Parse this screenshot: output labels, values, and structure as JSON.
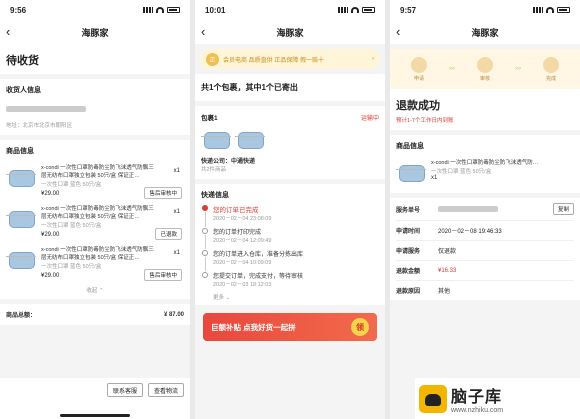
{
  "app_title": "海豚家",
  "screen1": {
    "time": "9:56",
    "page_title": "待收货",
    "recipient_label": "收货人信息",
    "address": "地址：北京市北京市朝阳区",
    "products_label": "商品信息",
    "products": [
      {
        "name": "x-condi 一次性口罩防毒防尘防飞沫透气防飘三层无纺布口罩独立包装 50只/盒 保证正…",
        "spec": "一次性口罩 蓝色 50只/盒",
        "price": "¥29.00",
        "qty": "x1",
        "action": "售后审核中"
      },
      {
        "name": "x-condi 一次性口罩防毒防尘防飞沫透气防飘三层无纺布口罩独立包装 50只/盒 保证正…",
        "spec": "一次性口罩 蓝色 50只/盒",
        "price": "¥29.00",
        "qty": "x1",
        "action": "已退款"
      },
      {
        "name": "x-condi 一次性口罩防毒防尘防飞沫透气防飘三层无纺布口罩独立包装 50只/盒 保证正…",
        "spec": "一次性口罩 蓝色 50只/盒",
        "price": "¥29.00",
        "qty": "x1",
        "action": "售后审核中"
      }
    ],
    "collapse": "收起 ⌃",
    "total_label": "商品总额：",
    "total_value": "¥ 87.00",
    "contact_btn": "联系客服",
    "logistics_btn": "查看物流"
  },
  "screen2": {
    "time": "10:01",
    "banner_text": "会员电商 品质直供   正品保障 假一赔十",
    "banner_icon": "正",
    "summary": "共1个包裹，其中1个已寄出",
    "package_label": "包裹1",
    "package_status": "运输中",
    "carrier": "快递公司：中通快递",
    "item_count": "共2件商品",
    "tracking_label": "快递信息",
    "events": [
      {
        "text": "您的订单已完成",
        "time": "2020－02－04 23:08:09",
        "active": true
      },
      {
        "text": "您的订单打印完成",
        "time": "2020－02－04 12:09:49",
        "active": false
      },
      {
        "text": "您的订单进入仓库，准备分拣出库",
        "time": "2020－02－04 10:09:09",
        "active": false
      },
      {
        "text": "您提交订单，完成支付，等待审核",
        "time": "2020－02－03 18:12:03",
        "active": false
      }
    ],
    "more": "更多 ⌄",
    "ad_text": "巨额补贴 点我好货一起拼",
    "ad_button": "领"
  },
  "screen3": {
    "time": "9:57",
    "steps": [
      "申请",
      "审核",
      "完成"
    ],
    "title": "退款成功",
    "subtitle": "预计1-7个工作日内到账",
    "products_label": "商品信息",
    "product": {
      "name": "x-condi 一次性口罩防毒防尘防飞沫透气防…",
      "spec": "一次性口罩 蓝色 50只/盒",
      "qty": "x1"
    },
    "rows": [
      {
        "k": "服务单号",
        "v": "",
        "btn": "复制"
      },
      {
        "k": "申请时间",
        "v": "2020－02－08 19:46:33"
      },
      {
        "k": "申请服务",
        "v": "仅退款"
      },
      {
        "k": "退款金额",
        "v": "¥16.33",
        "red": true
      },
      {
        "k": "退款原因",
        "v": "其他"
      }
    ]
  },
  "watermark": {
    "title": "脑子库",
    "url": "www.nzhiku.com"
  },
  "colors": {
    "accent": "#e03a2f",
    "gold": "#c98b1a"
  }
}
